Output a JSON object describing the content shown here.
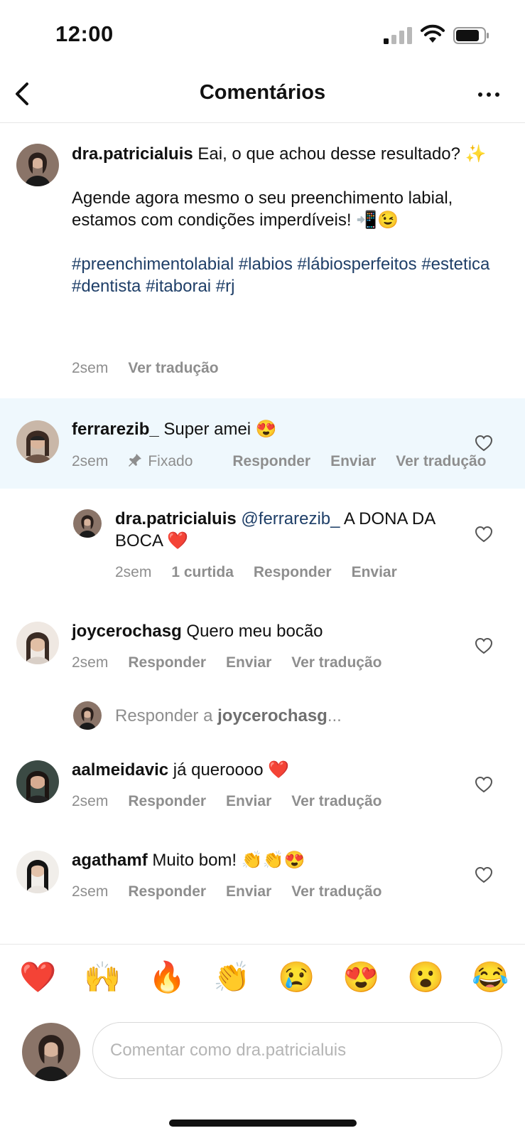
{
  "status_bar": {
    "time": "12:00"
  },
  "header": {
    "title": "Comentários",
    "back_icon": "chevron-left-icon",
    "more_icon": "more-horizontal-icon"
  },
  "caption": {
    "username": "dra.patricialuis",
    "line1": "Eai, o que achou desse resultado? ✨",
    "line2": "Agende agora mesmo o seu preenchimento labial, estamos com condições imperdíveis! 📲😉",
    "hashtags": "#preenchimentolabial #labios #lábiosperfeitos #estetica #dentista #itaborai #rj",
    "time": "2sem",
    "translate": "Ver tradução"
  },
  "comments": [
    {
      "username": "ferrarezib_",
      "text": "Super amei 😍",
      "time": "2sem",
      "pinned_label": "Fixado",
      "reply": "Responder",
      "send": "Enviar",
      "translate": "Ver tradução"
    },
    {
      "username": "dra.patricialuis",
      "mention": "@ferrarezib_",
      "text": "A DONA DA BOCA ❤️",
      "time": "2sem",
      "likes": "1 curtida",
      "reply": "Responder",
      "send": "Enviar"
    },
    {
      "username": "joycerochasg",
      "text": "Quero meu bocão",
      "time": "2sem",
      "reply": "Responder",
      "send": "Enviar",
      "translate": "Ver tradução"
    },
    {
      "username": "aalmeidavic",
      "text": "já queroooo ❤️",
      "time": "2sem",
      "reply": "Responder",
      "send": "Enviar",
      "translate": "Ver tradução"
    },
    {
      "username": "agathamf",
      "text": "Muito bom! 👏👏😍",
      "time": "2sem",
      "reply": "Responder",
      "send": "Enviar",
      "translate": "Ver tradução"
    }
  ],
  "reply_prompt": {
    "prefix": "Responder a",
    "username": "joycerochasg",
    "suffix": "..."
  },
  "emoji_bar": [
    "❤️",
    "🙌",
    "🔥",
    "👏",
    "😢",
    "😍",
    "😮",
    "😂"
  ],
  "composer": {
    "placeholder": "Comentar como dra.patricialuis"
  },
  "colors": {
    "link": "#1f3f68",
    "muted": "#8e8e8e",
    "pinned_bg": "#eff8fd"
  }
}
